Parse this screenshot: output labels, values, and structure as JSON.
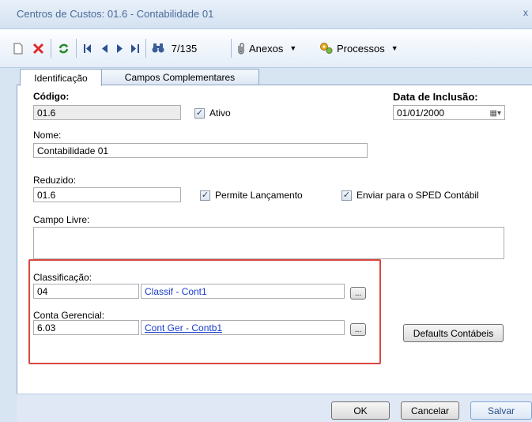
{
  "window": {
    "title": "Centros de Custos: 01.6 - Contabilidade 01",
    "close_label": "x"
  },
  "toolbar": {
    "record_position": "7/135",
    "attachments_label": "Anexos",
    "processes_label": "Processos"
  },
  "tabs": [
    {
      "label": "Identificação",
      "active": true
    },
    {
      "label": "Campos Complementares",
      "active": false
    }
  ],
  "form": {
    "codigo_label": "Código:",
    "codigo_value": "01.6",
    "ativo_label": "Ativo",
    "ativo_checked": true,
    "data_inclusao_label": "Data de Inclusão:",
    "data_inclusao_value": "01/01/2000",
    "nome_label": "Nome:",
    "nome_value": "Contabilidade 01",
    "reduzido_label": "Reduzido:",
    "reduzido_value": "01.6",
    "permite_lancamento_label": "Permite Lançamento",
    "permite_lancamento_checked": true,
    "enviar_sped_label": "Enviar para o SPED Contábil",
    "enviar_sped_checked": true,
    "campo_livre_label": "Campo Livre:",
    "campo_livre_value": "",
    "classificacao_label": "Classificação:",
    "classificacao_code": "04",
    "classificacao_desc": "Classif - Cont1",
    "conta_gerencial_label": "Conta Gerencial:",
    "conta_gerencial_code": "6.03",
    "conta_gerencial_desc": "Cont Ger - Contb1",
    "browse_label": "...",
    "defaults_button": "Defaults Contábeis"
  },
  "footer": {
    "ok": "OK",
    "cancel": "Cancelar",
    "save": "Salvar"
  },
  "colors": {
    "highlight_border": "#d9473f",
    "link": "#1a3ccc",
    "delete_red": "#e02a2a",
    "refresh_green": "#2d8a2d"
  }
}
